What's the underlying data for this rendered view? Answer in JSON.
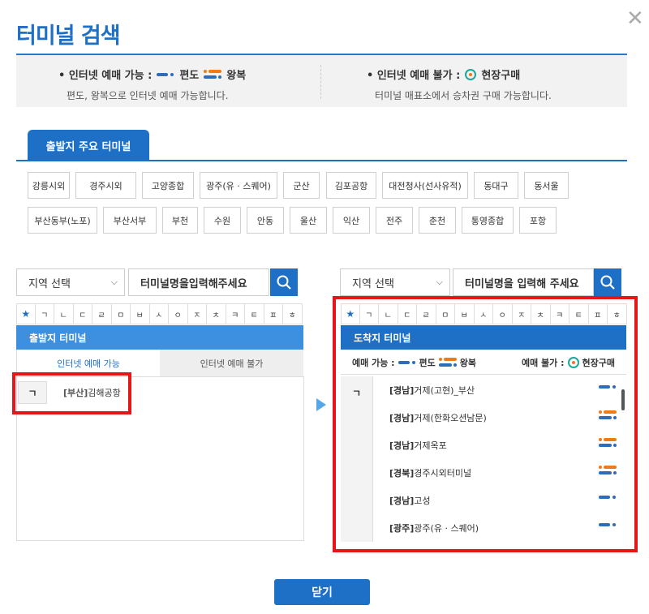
{
  "title": "터미널 검색",
  "info": {
    "left_label": "• 인터넷 예매 가능 :",
    "oneway": "편도",
    "round": "왕복",
    "left_sub": "편도, 왕복으로 인터넷 예매 가능합니다.",
    "right_label": "• 인터넷 예매 불가 :",
    "onsite": "현장구매",
    "right_sub": "터미널 매표소에서 승차권 구매 가능합니다."
  },
  "major_tab": "출발지 주요 터미널",
  "major_terminals": [
    "강릉시외",
    "경주시외",
    "고양종합",
    "광주(유 · 스퀘어)",
    "군산",
    "김포공항",
    "대전청사(선사유적)",
    "동대구",
    "동서울",
    "부산동부(노포)",
    "부산서부",
    "부천",
    "수원",
    "안동",
    "울산",
    "익산",
    "전주",
    "춘천",
    "통영종합",
    "포항"
  ],
  "consonants": [
    "★",
    "ㄱ",
    "ㄴ",
    "ㄷ",
    "ㄹ",
    "ㅁ",
    "ㅂ",
    "ㅅ",
    "ㅇ",
    "ㅈ",
    "ㅊ",
    "ㅋ",
    "ㅌ",
    "ㅍ",
    "ㅎ"
  ],
  "departure": {
    "region_select": "지역 선택",
    "search_placeholder": "터미널명을입력해주세요",
    "panel_title": "출발지 터미널",
    "subtab_online": "인터넷 예매 가능",
    "subtab_offline": "인터넷 예매 불가",
    "index": "ㄱ",
    "items": [
      {
        "region": "[부산]",
        "name": "김해공항"
      }
    ]
  },
  "arrival": {
    "region_select": "지역 선택",
    "search_placeholder": "터미널명을 입력해 주세요",
    "panel_title": "도착지 터미널",
    "legend_available": "예매 가능 :",
    "legend_oneway": "편도",
    "legend_round": "왕복",
    "legend_unavailable": "예매 불가 :",
    "legend_onsite": "현장구매",
    "index": "ㄱ",
    "items": [
      {
        "region": "[경남]",
        "name": "거제(고현)_부산",
        "type": "oneway"
      },
      {
        "region": "[경남]",
        "name": "거제(한화오션남문)",
        "type": "round"
      },
      {
        "region": "[경남]",
        "name": "거제옥포",
        "type": "round"
      },
      {
        "region": "[경북]",
        "name": "경주시외터미널",
        "type": "round"
      },
      {
        "region": "[경남]",
        "name": "고성",
        "type": "oneway"
      },
      {
        "region": "[광주]",
        "name": "광주(유 · 스퀘어)",
        "type": "oneway"
      }
    ]
  },
  "close_button": "닫기",
  "colors": {
    "primary": "#1e6fc6",
    "highlight": "#e8141c",
    "light_blue": "#3d8fe0",
    "orange": "#f07b16",
    "teal": "#1aa89a"
  }
}
